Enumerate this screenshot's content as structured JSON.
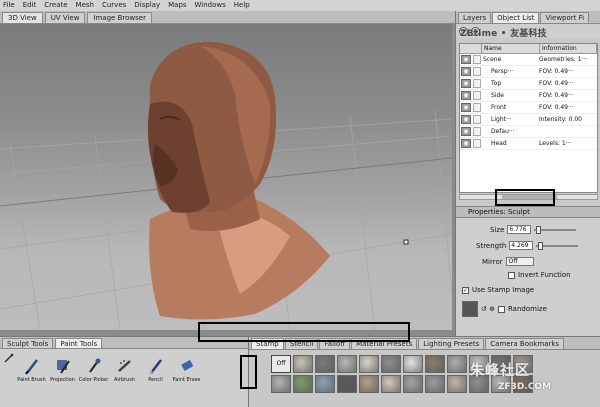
{
  "menubar": [
    "File",
    "Edit",
    "Create",
    "Mesh",
    "Curves",
    "Display",
    "Maps",
    "Windows",
    "Help"
  ],
  "viewport_tabs": [
    "3D View",
    "UV View",
    "Image Browser"
  ],
  "right_tabs": [
    "Layers",
    "Object List",
    "Viewport Fi"
  ],
  "watermark_text": "ZBtime • 友基科技",
  "object_list": {
    "columns": [
      "Name",
      "Information"
    ],
    "rows": [
      {
        "name": "Scene",
        "info": "Geometries: 1···"
      },
      {
        "name": "Persp···",
        "info": "FOV: 0.49···"
      },
      {
        "name": "Top",
        "info": "FOV: 0.49···"
      },
      {
        "name": "Side",
        "info": "FOV: 0.49···"
      },
      {
        "name": "Front",
        "info": "FOV: 0.49···"
      },
      {
        "name": "Light···",
        "info": "Intensity: 0.00"
      },
      {
        "name": "Defau···",
        "info": ""
      },
      {
        "name": "Head",
        "info": "Levels: 1···"
      }
    ]
  },
  "properties": {
    "title": "Properties: Sculpt",
    "size_label": "Size",
    "size_value": "6.776",
    "strength_label": "Strength",
    "strength_value": "4.269",
    "mirror_label": "Mirror",
    "mirror_value": "Off",
    "invert_label": "Invert Function",
    "stamp_label": "Use Stamp Image",
    "randomize_label": "Randomize"
  },
  "tool_tabs": [
    "Sculpt Tools",
    "Paint Tools"
  ],
  "paint_tools": [
    "Paint Brush",
    "Projection",
    "Color Picker",
    "Airbrush",
    "Pencil",
    "Paint Erase"
  ],
  "stamp_tabs": [
    "Stamp",
    "Stencil",
    "Falloff",
    "Material Presets",
    "Lighting Presets",
    "Camera Bookmarks"
  ],
  "stamp_off_label": "Off",
  "corner_watermark": "朱峰社区",
  "corner_watermark_sub": "ZF3D.COM",
  "stamp_colors": [
    "#9a9a9a",
    "#c9c3b8",
    "#7b7b7b",
    "#b7b7b7",
    "#d9d3c8",
    "#8e8e8e",
    "#e4e4e4",
    "#8a7c6c",
    "#aeaeae",
    "#c4c4c4",
    "#707070",
    "#a09890",
    "#b3b3b3",
    "#7d9a6a",
    "#8aa3b5",
    "#5a5a5a",
    "#b0a08a",
    "#d0c8b8",
    "#a4a4a4",
    "#9c9c9c",
    "#c0b6a8",
    "#8f8f8f",
    "#bcbcbc",
    "#7a6d5e"
  ]
}
